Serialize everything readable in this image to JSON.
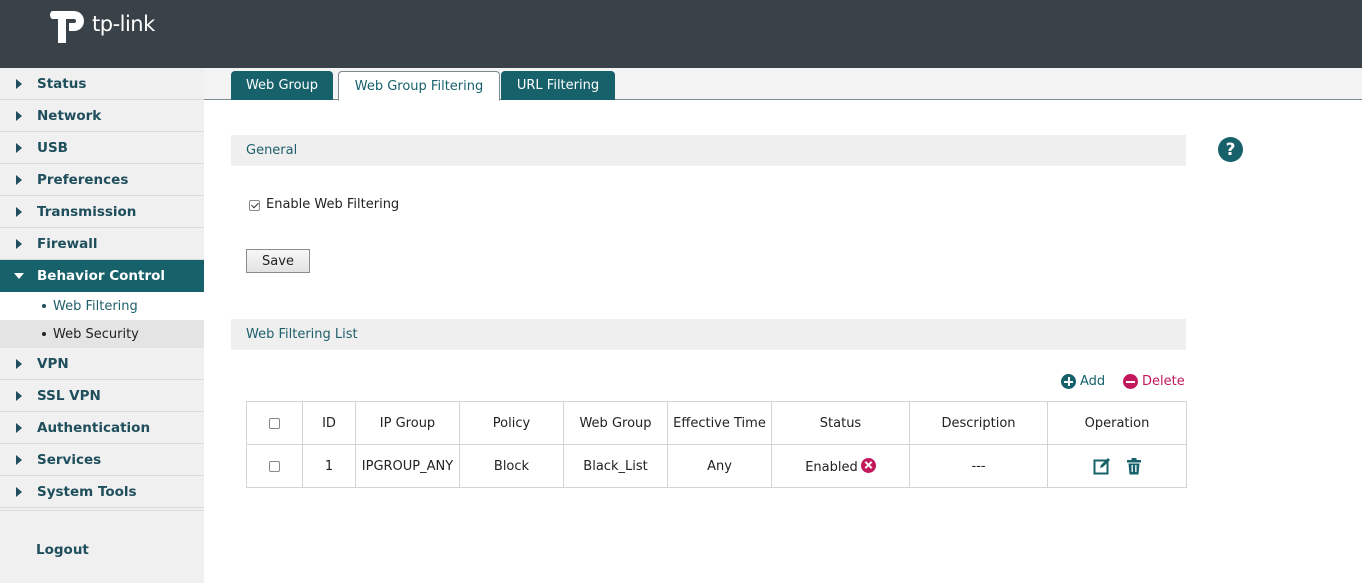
{
  "brand": {
    "logo_text": "tp-link"
  },
  "sidebar": {
    "items": [
      {
        "label": "Status"
      },
      {
        "label": "Network"
      },
      {
        "label": "USB"
      },
      {
        "label": "Preferences"
      },
      {
        "label": "Transmission"
      },
      {
        "label": "Firewall"
      },
      {
        "label": "Behavior Control"
      },
      {
        "label": "VPN"
      },
      {
        "label": "SSL VPN"
      },
      {
        "label": "Authentication"
      },
      {
        "label": "Services"
      },
      {
        "label": "System Tools"
      }
    ],
    "sub_items": [
      {
        "label": "Web Filtering"
      },
      {
        "label": "Web Security"
      }
    ],
    "logout_label": "Logout"
  },
  "tabs": [
    {
      "label": "Web Group"
    },
    {
      "label": "Web Group Filtering"
    },
    {
      "label": "URL Filtering"
    }
  ],
  "general": {
    "heading": "General",
    "enable_label": "Enable Web Filtering",
    "enable_checked": true,
    "save_label": "Save"
  },
  "help_icon": "?",
  "list": {
    "heading": "Web Filtering List",
    "add_label": "Add",
    "delete_label": "Delete",
    "columns": [
      "ID",
      "IP Group",
      "Policy",
      "Web Group",
      "Effective Time",
      "Status",
      "Description",
      "Operation"
    ],
    "rows": [
      {
        "id": "1",
        "ip_group": "IPGROUP_ANY",
        "policy": "Block",
        "web_group": "Black_List",
        "effective_time": "Any",
        "status": "Enabled",
        "description": "---"
      }
    ]
  },
  "colors": {
    "accent": "#17616b",
    "danger": "#c2185b",
    "topbar": "#384248"
  }
}
